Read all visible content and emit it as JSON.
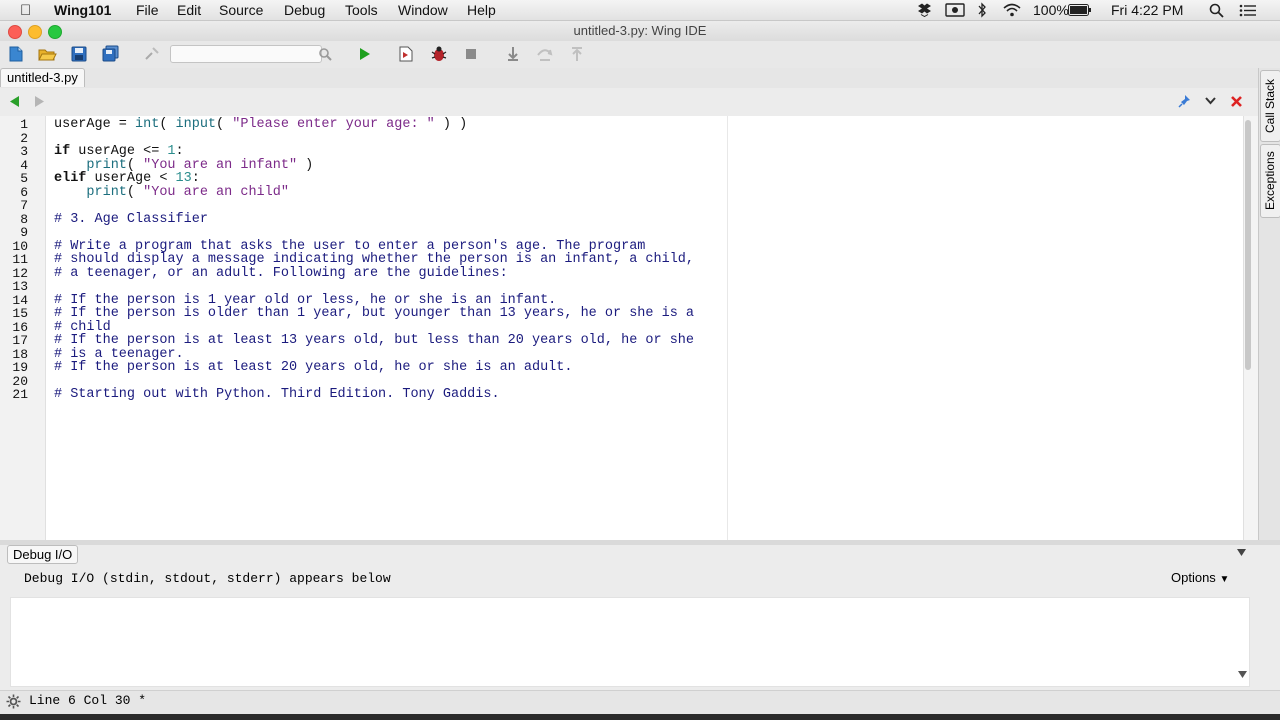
{
  "menubar": {
    "app_name": "Wing101",
    "items": [
      "File",
      "Edit",
      "Source",
      "Debug",
      "Tools",
      "Window",
      "Help"
    ],
    "battery": "100%",
    "clock": "Fri 4:22 PM"
  },
  "window": {
    "title": "untitled-3.py: Wing IDE"
  },
  "editor": {
    "tab_label": "untitled-3.py",
    "lines": [
      {
        "n": "1",
        "html": "userAge = <span class=\"bi\">int</span>( <span class=\"bi\">input</span>( <span class=\"str\">\"Please enter your age: \"</span> ) )"
      },
      {
        "n": "2",
        "html": ""
      },
      {
        "n": "3",
        "html": "<span class=\"kw\">if</span> userAge &lt;= <span class=\"num\">1</span>:"
      },
      {
        "n": "4",
        "html": "    <span class=\"bi\">print</span>( <span class=\"str\">\"You are an infant\"</span> )"
      },
      {
        "n": "5",
        "html": "<span class=\"kw\">elif</span> userAge &lt; <span class=\"num\">13</span>:"
      },
      {
        "n": "6",
        "html": "    <span class=\"bi\">print</span>( <span class=\"str\">\"You are an child\"</span>"
      },
      {
        "n": "7",
        "html": ""
      },
      {
        "n": "8",
        "html": "<span class=\"cm\"># 3. Age Classifier</span>"
      },
      {
        "n": "9",
        "html": ""
      },
      {
        "n": "10",
        "html": "<span class=\"cm\"># Write a program that asks the user to enter a person's age. The program</span>"
      },
      {
        "n": "11",
        "html": "<span class=\"cm\"># should display a message indicating whether the person is an infant, a child,</span>"
      },
      {
        "n": "12",
        "html": "<span class=\"cm\"># a teenager, or an adult. Following are the guidelines:</span>"
      },
      {
        "n": "13",
        "html": ""
      },
      {
        "n": "14",
        "html": "<span class=\"cm\"># If the person is 1 year old or less, he or she is an infant.</span>"
      },
      {
        "n": "15",
        "html": "<span class=\"cm\"># If the person is older than 1 year, but younger than 13 years, he or she is a</span>"
      },
      {
        "n": "16",
        "html": "<span class=\"cm\"># child</span>"
      },
      {
        "n": "17",
        "html": "<span class=\"cm\"># If the person is at least 13 years old, but less than 20 years old, he or she</span>"
      },
      {
        "n": "18",
        "html": "<span class=\"cm\"># is a teenager.</span>"
      },
      {
        "n": "19",
        "html": "<span class=\"cm\"># If the person is at least 20 years old, he or she is an adult.</span>"
      },
      {
        "n": "20",
        "html": ""
      },
      {
        "n": "21",
        "html": "<span class=\"cm\"># Starting out with Python. Third Edition. Tony Gaddis.</span>"
      }
    ]
  },
  "side_tabs": [
    "Call Stack",
    "Exceptions"
  ],
  "debug": {
    "tab_label": "Debug I/O",
    "description": "Debug I/O (stdin, stdout, stderr) appears below",
    "options_label": "Options"
  },
  "status": "Line 6 Col 30 *"
}
